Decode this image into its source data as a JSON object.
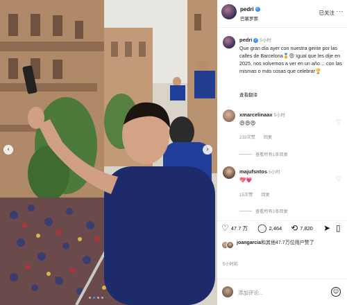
{
  "header": {
    "username": "pedri",
    "subtitle": "巴塞罗那",
    "follow_label": "已关注",
    "more_icon": "more-horizontal-icon"
  },
  "caption": {
    "username": "pedri",
    "time": "5小时",
    "text": "Que gran día ayer con nuestra gente por las calles de Barcelona🏅😍 Igual que les dije en 2025, nos volvemos a ver en un año… con las mismas o más cosas que celebrar🏆",
    "translate_label": "查看翻译"
  },
  "comments": [
    {
      "username": "xmarcelinaax",
      "time": "5小时",
      "body": "😍😍😍",
      "likes": "233次赞",
      "reply_label": "回复",
      "view_replies": "查看所有1条回复"
    },
    {
      "username": "majufsntos",
      "time": "5小时",
      "body": "💖💗",
      "likes": "15次赞",
      "reply_label": "回复",
      "view_replies": "查看所有2条回复"
    }
  ],
  "actions": {
    "likes_count": "47.7 万",
    "comments_count": "2,464",
    "reposts_count": "7,820"
  },
  "liked_by": {
    "username": "joangarcia",
    "text": "和其他47.7万位用户赞了"
  },
  "post_time": "5小时前",
  "add_comment": {
    "placeholder": "添加评论..."
  },
  "colors": {
    "verified": "#3897f0",
    "text_secondary": "#8e8e8e",
    "divider": "#efefef"
  }
}
